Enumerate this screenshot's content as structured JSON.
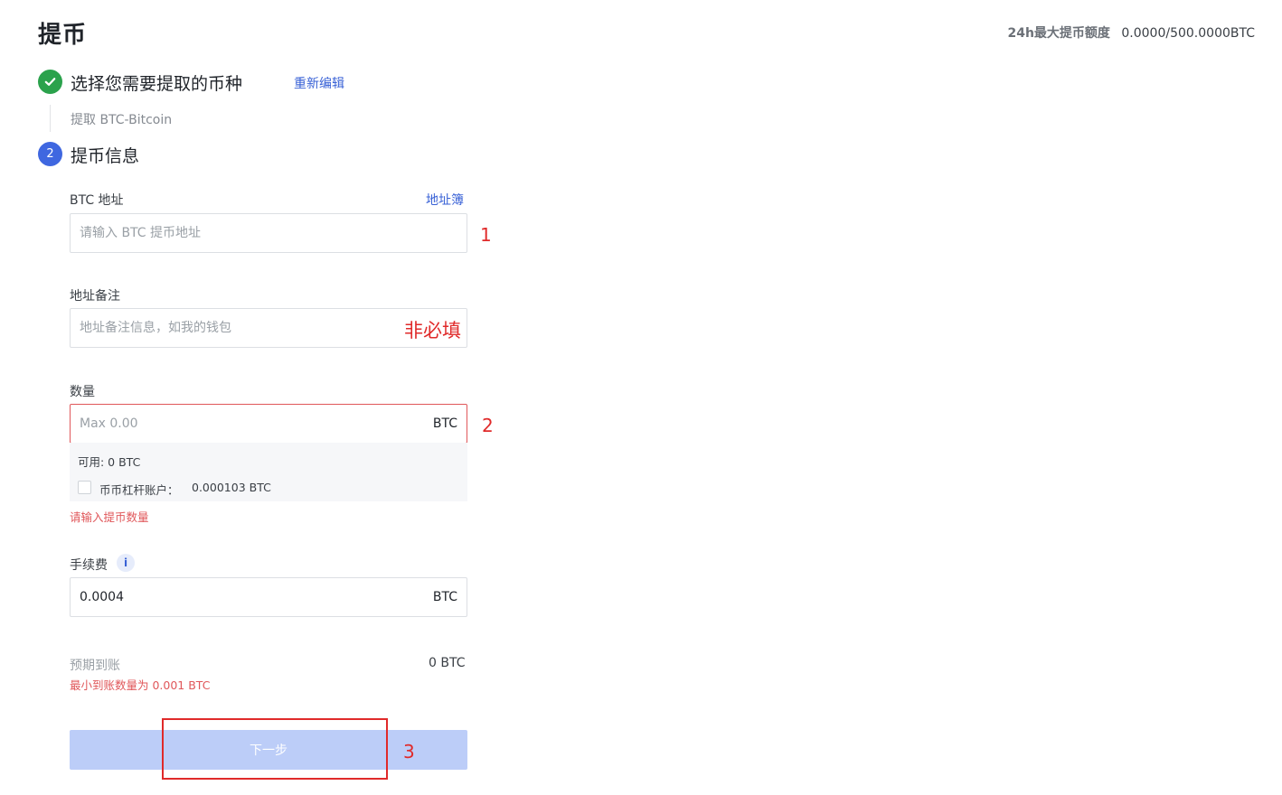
{
  "page": {
    "title": "提币"
  },
  "limit": {
    "label": "24h最大提币额度",
    "value": "0.0000/500.0000BTC"
  },
  "step1": {
    "title": "选择您需要提取的币种",
    "edit_link": "重新编辑",
    "selected": "提取 BTC-Bitcoin",
    "icon": "check-icon",
    "color": "#2ba24c"
  },
  "step2": {
    "number": "2",
    "title": "提币信息",
    "color": "#3f67e0"
  },
  "address": {
    "label": "BTC 地址",
    "book_link": "地址簿",
    "placeholder": "请输入 BTC 提币地址",
    "value": ""
  },
  "remark": {
    "label": "地址备注",
    "placeholder": "地址备注信息，如我的钱包",
    "value": ""
  },
  "amount": {
    "label": "数量",
    "placeholder": "Max 0.00",
    "suffix": "BTC",
    "available": "可用:  0 BTC",
    "margin_label": "币币杠杆账户：",
    "margin_value": "0.000103 BTC",
    "error": "请输入提币数量"
  },
  "fee": {
    "label": "手续费",
    "info_icon": "i",
    "value": "0.0004",
    "suffix": "BTC"
  },
  "expected": {
    "label": "预期到账",
    "value": "0 BTC",
    "min_note": "最小到账数量为 0.001 BTC"
  },
  "next_button": {
    "label": "下一步"
  },
  "annotations": {
    "a1": "1",
    "a2": "2",
    "a3": "3",
    "optional": "非必填",
    "color": "#e02a2a"
  }
}
